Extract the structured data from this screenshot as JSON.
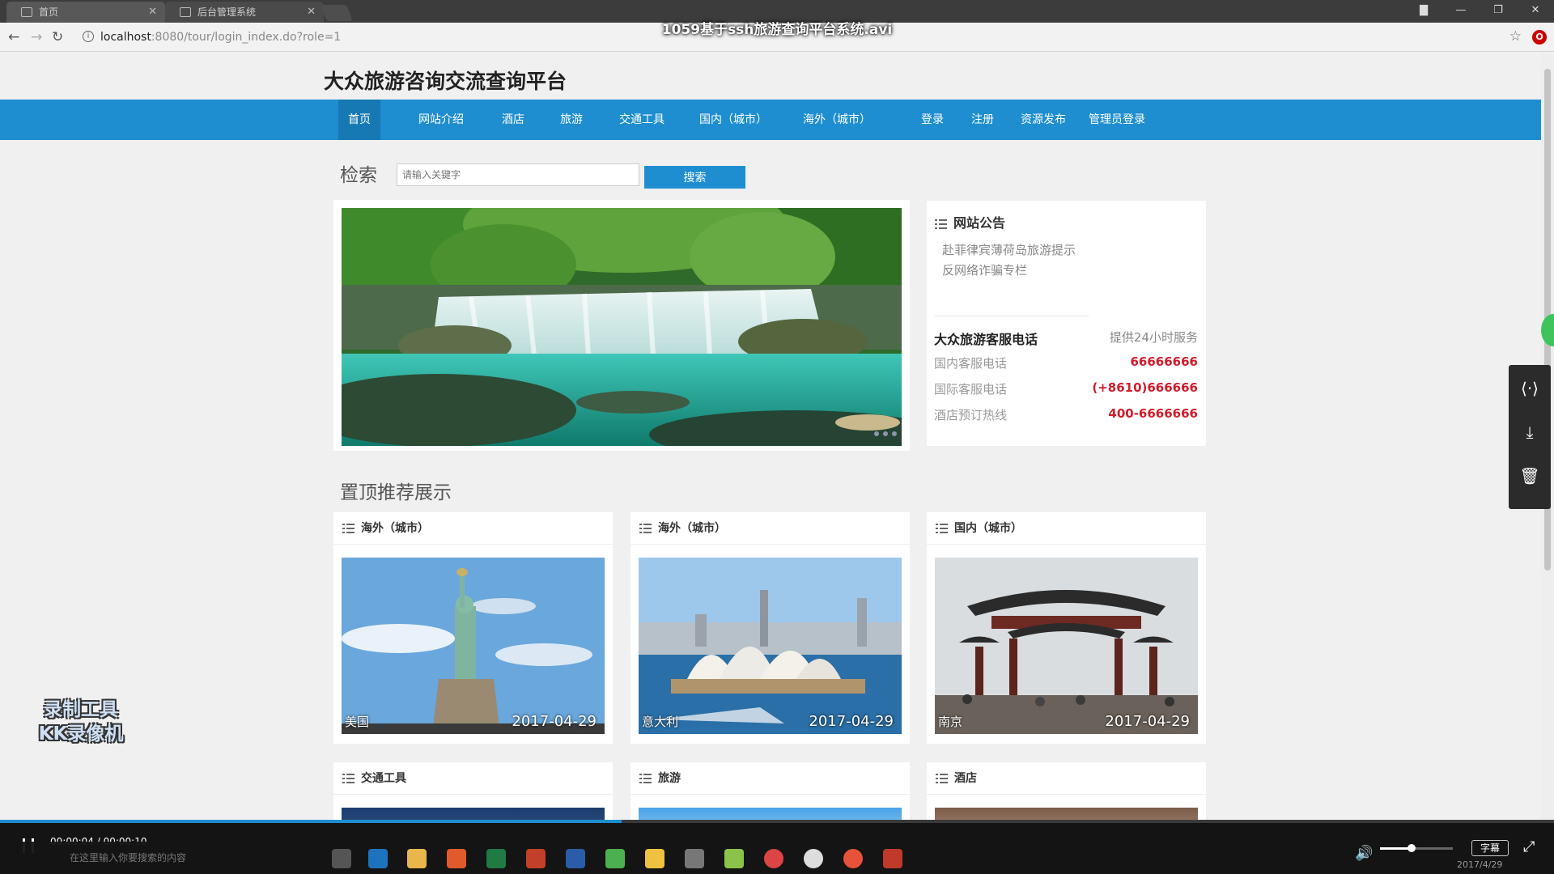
{
  "video": {
    "title": "1059基于ssh旅游查询平台系统.avi",
    "time": "00:00:04 / 00:00:10",
    "progress": 0.4,
    "subtitle_btn": "字幕",
    "volume": 0.42
  },
  "browser": {
    "tabs": [
      {
        "label": "首页"
      },
      {
        "label": "后台管理系统"
      }
    ],
    "url_host": "localhost",
    "url_rest": ":8080/tour/login_index.do?role=1"
  },
  "site": {
    "title": "大众旅游咨询交流查询平台",
    "nav": [
      "首页",
      "网站介绍",
      "酒店",
      "旅游",
      "交通工具",
      "国内（城市）",
      "海外（城市）",
      "登录",
      "注册",
      "资源发布",
      "管理员登录"
    ]
  },
  "search": {
    "label": "检索",
    "placeholder": "请输入关键字",
    "button": "搜索"
  },
  "notice": {
    "title": "网站公告",
    "items": [
      "赴菲律宾薄荷岛旅游提示",
      "反网络诈骗专栏"
    ],
    "phone_title": "大众旅游客服电话",
    "phone_note": "提供24小时服务",
    "phones": [
      {
        "label": "国内客服电话",
        "value": "66666666"
      },
      {
        "label": "国际客服电话",
        "value": "(+8610)666666"
      },
      {
        "label": "酒店预订热线",
        "value": "400-6666666"
      }
    ]
  },
  "recommend": {
    "title": "置顶推荐展示",
    "cards": [
      {
        "category": "海外（城市）",
        "caption": "美国",
        "date": "2017-04-29"
      },
      {
        "category": "海外（城市）",
        "caption": "意大利",
        "date": "2017-04-29"
      },
      {
        "category": "国内（城市）",
        "caption": "南京",
        "date": "2017-04-29"
      },
      {
        "category": "交通工具"
      },
      {
        "category": "旅游"
      },
      {
        "category": "酒店"
      }
    ]
  },
  "watermark": {
    "line1": "录制工具",
    "line2": "KK录像机"
  },
  "taskbar": {
    "search_placeholder": "在这里输入你要搜索的内容",
    "date": "2017/4/29"
  }
}
